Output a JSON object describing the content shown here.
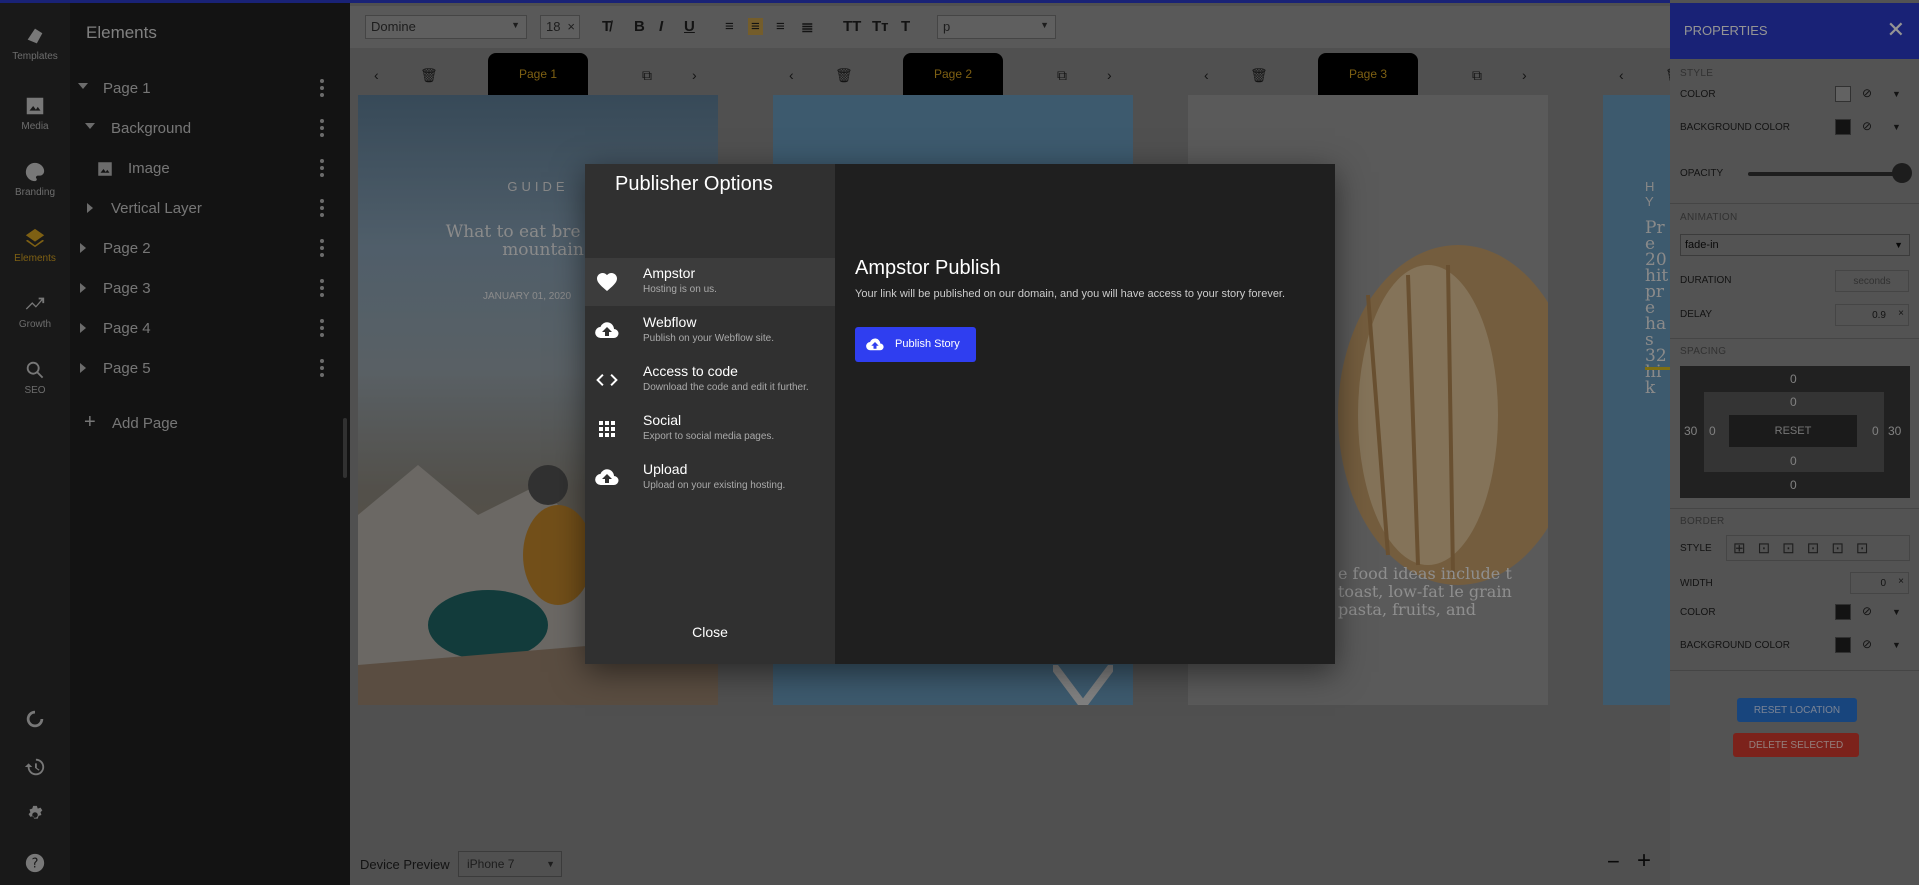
{
  "rail": {
    "items": [
      {
        "label": "Templates",
        "icon": "templates-icon"
      },
      {
        "label": "Media",
        "icon": "image-icon"
      },
      {
        "label": "Branding",
        "icon": "palette-icon"
      },
      {
        "label": "Elements",
        "icon": "layers-icon"
      },
      {
        "label": "Growth",
        "icon": "trending-icon"
      },
      {
        "label": "SEO",
        "icon": "search-icon"
      }
    ],
    "bottom_icons": [
      "sync-icon",
      "history-icon",
      "gear-icon",
      "help-icon"
    ]
  },
  "layers": {
    "title": "Elements",
    "rows": [
      {
        "label": "Page 1"
      },
      {
        "label": "Background"
      },
      {
        "label": "Image"
      },
      {
        "label": "Vertical Layer"
      },
      {
        "label": "Page 2"
      },
      {
        "label": "Page 3"
      },
      {
        "label": "Page 4"
      },
      {
        "label": "Page 5"
      }
    ],
    "add_page": "Add Page"
  },
  "toolbar": {
    "font": "Domine",
    "size": "18",
    "block": "p"
  },
  "pages": [
    {
      "tab": "Page 1",
      "heading": "GUIDE",
      "title": "What to eat bre a  l the mountain",
      "date": "JANUARY 01, 2020"
    },
    {
      "tab": "Page 2"
    },
    {
      "tab": "Page 3",
      "text": "e food ideas include t toast, low-fat le grain pasta, fruits, and"
    },
    {
      "tab": "",
      "text": "H Y",
      "body": "Pre 20 hit pre has 32 hik"
    }
  ],
  "properties": {
    "title": "PROPERTIES",
    "style_h": "STYLE",
    "color": "COLOR",
    "bg_color": "BACKGROUND COLOR",
    "opacity": "OPACITY",
    "opacity_value": 1.0,
    "animation_h": "ANIMATION",
    "animation": "fade-in",
    "duration": "DURATION",
    "duration_placeholder": "seconds",
    "delay": "DELAY",
    "delay_value": "0.9",
    "spacing_h": "SPACING",
    "margin": {
      "top": "0",
      "right": "30",
      "bottom": "0",
      "left": "30"
    },
    "padding": {
      "top": "0",
      "right": "0",
      "bottom": "0",
      "left": "0"
    },
    "reset": "RESET",
    "border_h": "BORDER",
    "border_style": "STYLE",
    "width": "WIDTH",
    "width_value": "0",
    "border_color": "COLOR",
    "border_bg": "BACKGROUND COLOR",
    "reset_location": "RESET LOCATION",
    "delete_selected": "DELETE SELECTED",
    "colors": {
      "accent": "#2b3bcc",
      "reset_btn": "#2a78d8",
      "delete_btn": "#d63b2f"
    }
  },
  "dialog": {
    "title": "Publisher Options",
    "options": [
      {
        "title": "Ampstor",
        "sub": "Hosting is on us.",
        "icon": "heart-icon"
      },
      {
        "title": "Webflow",
        "sub": "Publish on your Webflow site.",
        "icon": "cloud-upload-icon"
      },
      {
        "title": "Access to code",
        "sub": "Download the code and edit it further.",
        "icon": "code-icon"
      },
      {
        "title": "Social",
        "sub": "Export to social media pages.",
        "icon": "grid-icon"
      },
      {
        "title": "Upload",
        "sub": "Upload on your existing hosting.",
        "icon": "cloud-upload-icon"
      }
    ],
    "close": "Close",
    "publish_title": "Ampstor Publish",
    "publish_desc": "Your link will be published on our domain, and you will have access to your story forever.",
    "publish_btn": "Publish Story"
  },
  "bottom": {
    "device_label": "Device Preview",
    "device": "iPhone 7"
  }
}
